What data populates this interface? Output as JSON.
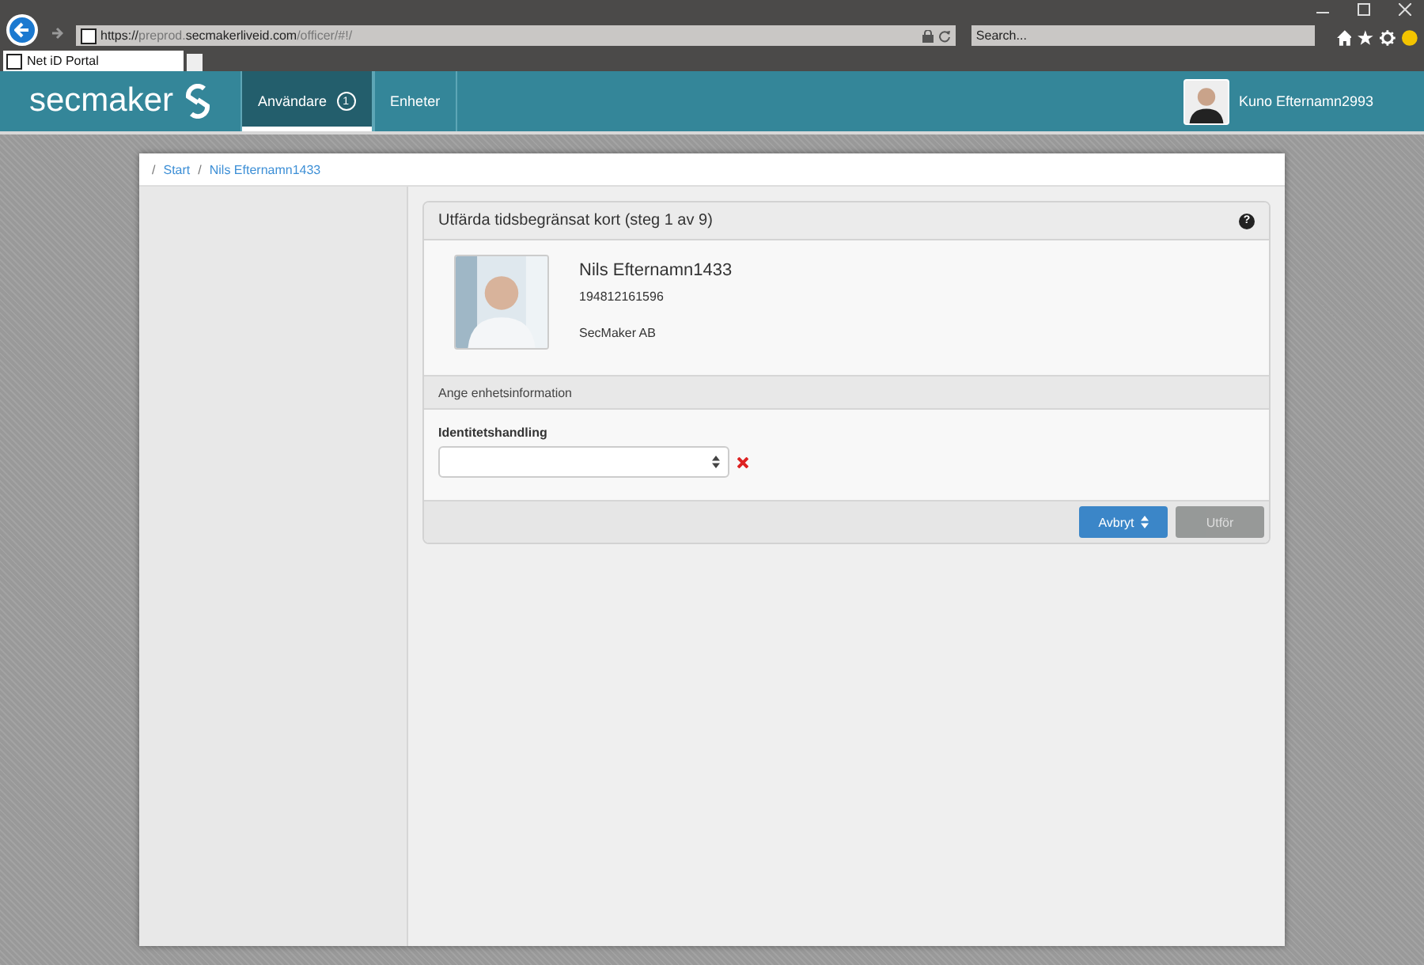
{
  "browser": {
    "url_parts": [
      {
        "text": "https://",
        "strong": true
      },
      {
        "text": "preprod.",
        "strong": false
      },
      {
        "text": "secmakerliveid.com",
        "strong": true
      },
      {
        "text": "/officer/#!/",
        "strong": false
      }
    ],
    "search": {
      "placeholder": "Search..."
    },
    "tabs": [
      {
        "title": "Net iD Portal",
        "selected": true
      }
    ]
  },
  "app": {
    "logo": "secmaker",
    "nav": [
      {
        "label": "Användare",
        "badge": "1",
        "selected": true
      },
      {
        "label": "Enheter",
        "selected": false
      }
    ],
    "user": {
      "name": "Kuno Efternamn2993"
    }
  },
  "breadcrumb": [
    {
      "separator": "/",
      "label": "Start"
    },
    {
      "separator": "/",
      "label": "Nils Efternamn1433"
    }
  ],
  "panel": {
    "title": "Utfärda tidsbegränsat kort (steg 1 av 9)",
    "help": "?",
    "person": {
      "name": "Nils Efternamn1433",
      "id": "194812161596",
      "org": "SecMaker AB"
    },
    "section": "Ange enhetsinformation",
    "field": {
      "label": "Identitetshandling",
      "invalid": true
    },
    "buttons": [
      {
        "label": "Avbryt",
        "kind": "primary",
        "disabled": false
      },
      {
        "label": "Utför",
        "kind": "default",
        "disabled": true
      }
    ]
  }
}
